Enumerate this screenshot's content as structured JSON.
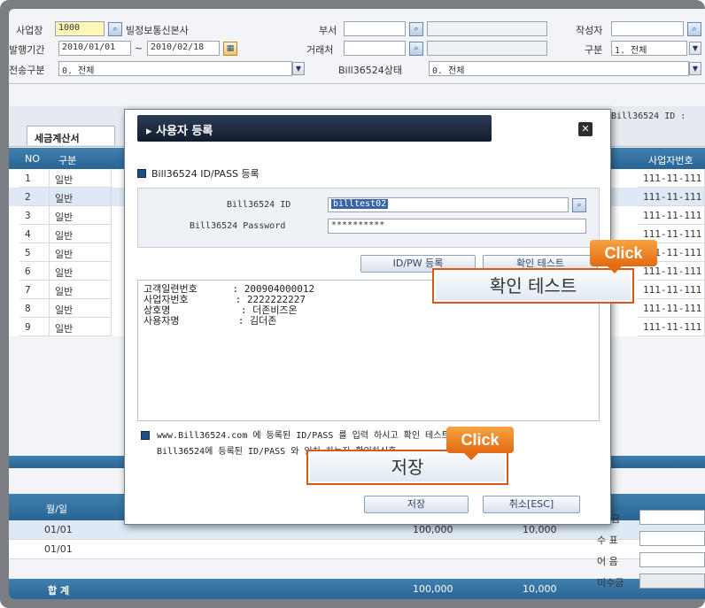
{
  "header": {
    "business_label": "사업장",
    "business_code": "1000",
    "business_name": "빌정보통신본사",
    "dept_label": "부서",
    "writer_label": "작성자",
    "period_label": "발행기간",
    "date_from": "2010/01/01",
    "date_sep": "~",
    "date_to": "2010/02/18",
    "partner_label": "거래처",
    "type_label": "구분",
    "type_value": "1. 전체",
    "send_label": "전송구분",
    "send_value": "0. 전체",
    "bill_status_label": "Bill36524상태",
    "bill_status_value": "0. 전체",
    "bill_id_label": "Bill36524 ID :"
  },
  "tab": {
    "label": "세금계산서"
  },
  "grid": {
    "col_no": "NO",
    "col_type": "구분",
    "col_bizno": "사업자번호",
    "rows": [
      {
        "no": "1",
        "type": "일반",
        "bizno": "111-11-111"
      },
      {
        "no": "2",
        "type": "일반",
        "bizno": "111-11-111"
      },
      {
        "no": "3",
        "type": "일반",
        "bizno": "111-11-111"
      },
      {
        "no": "4",
        "type": "일반",
        "bizno": "111-11-111"
      },
      {
        "no": "5",
        "type": "일반",
        "bizno": "111-11-111"
      },
      {
        "no": "6",
        "type": "일반",
        "bizno": "111-11-111"
      },
      {
        "no": "7",
        "type": "일반",
        "bizno": "111-11-111"
      },
      {
        "no": "8",
        "type": "일반",
        "bizno": "111-11-111"
      },
      {
        "no": "9",
        "type": "일반",
        "bizno": "111-11-111"
      }
    ]
  },
  "lower": {
    "col_date": "월/일",
    "rows": [
      {
        "date": "01/01",
        "amount": "100,000",
        "tax": "10,000"
      },
      {
        "date": "01/01",
        "amount": "",
        "tax": ""
      }
    ],
    "total_label": "합  계",
    "total_amount": "100,000",
    "total_tax": "10,000",
    "side_labels": [
      "금",
      "수 표",
      "어 음",
      "미수금"
    ]
  },
  "modal": {
    "title": "사용자 등록",
    "close_icon": "close-icon",
    "section_title": "Bill36524 ID/PASS 등록",
    "id_label": "Bill36524 ID",
    "id_value": "billtest02",
    "pw_label": "Bill36524 Password",
    "pw_value": "**********",
    "register_button": "ID/PW 등록",
    "test_button": "확인 테스트",
    "info_lines": "고객일련번호      : 200904000012\n사업자번호        : 2222222227\n상호명            : 더존비즈온\n사용자명          : 김더존",
    "notice_line1": "www.Bill36524.com 에 등록된 ID/PASS 를 입력 하시고 확인 테스트를 클릭하세요.",
    "notice_line2": "Bill36524에 등록된 ID/PASS 와 일치 하는지 확인하신후",
    "save_button": "저장",
    "cancel_button": "취소[ESC]"
  },
  "callouts": {
    "click_label": "Click",
    "test_big": "확인 테스트",
    "save_big": "저장"
  }
}
